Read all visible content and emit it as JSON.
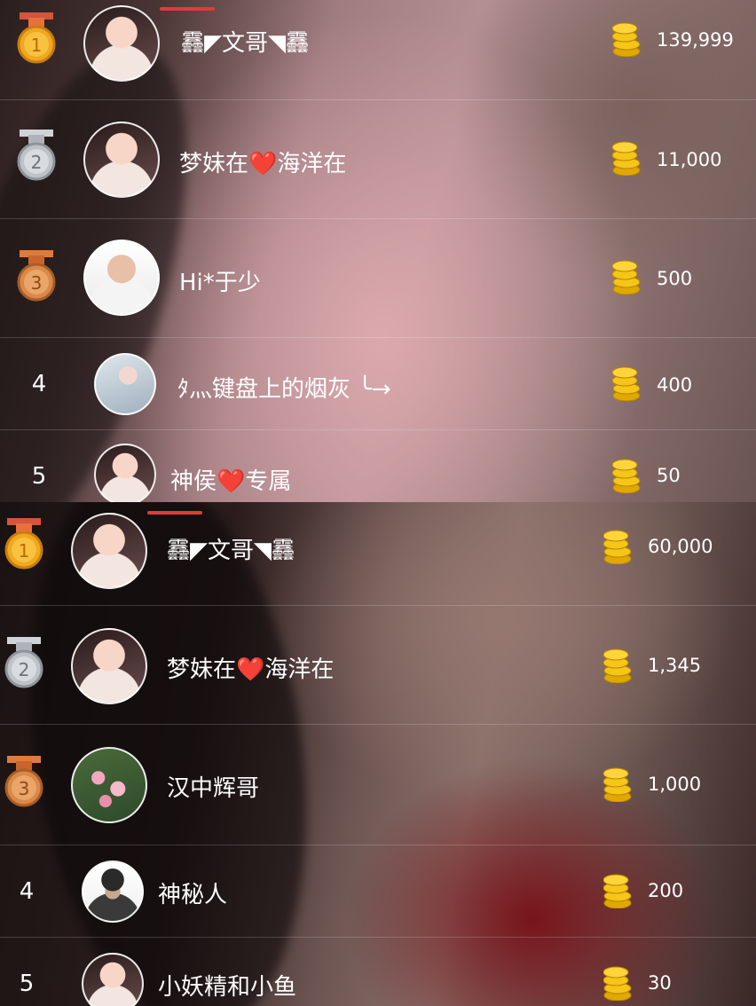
{
  "colors": {
    "accent_red": "#e23a3a",
    "coin_gold": "#f5c518",
    "gold_medal": "#f0a81e",
    "silver_medal": "#bfc3c8",
    "bronze_medal": "#d98a4a"
  },
  "panels": [
    {
      "rows": [
        {
          "rank": "1",
          "medal": "gold",
          "name": "䨺◤文哥◥䨺",
          "amount": "139,999"
        },
        {
          "rank": "2",
          "medal": "silver",
          "name": "梦妹在❤️海洋在",
          "amount": "11,000"
        },
        {
          "rank": "3",
          "medal": "bronze",
          "name": "Hi*于少",
          "amount": "500"
        },
        {
          "rank": "4",
          "medal": "",
          "name": "ﾀ灬键盘上的烟灰 ╰→",
          "amount": "400"
        },
        {
          "rank": "5",
          "medal": "",
          "name": "神侯❤️专属",
          "amount": "50"
        }
      ]
    },
    {
      "rows": [
        {
          "rank": "1",
          "medal": "gold",
          "name": "䨺◤文哥◥䨺",
          "amount": "60,000"
        },
        {
          "rank": "2",
          "medal": "silver",
          "name": "梦妹在❤️海洋在",
          "amount": "1,345"
        },
        {
          "rank": "3",
          "medal": "bronze",
          "name": "汉中辉哥",
          "amount": "1,000"
        },
        {
          "rank": "4",
          "medal": "",
          "name": "神秘人",
          "amount": "200"
        },
        {
          "rank": "5",
          "medal": "",
          "name": "小妖精和小鱼",
          "amount": "30"
        }
      ]
    }
  ]
}
